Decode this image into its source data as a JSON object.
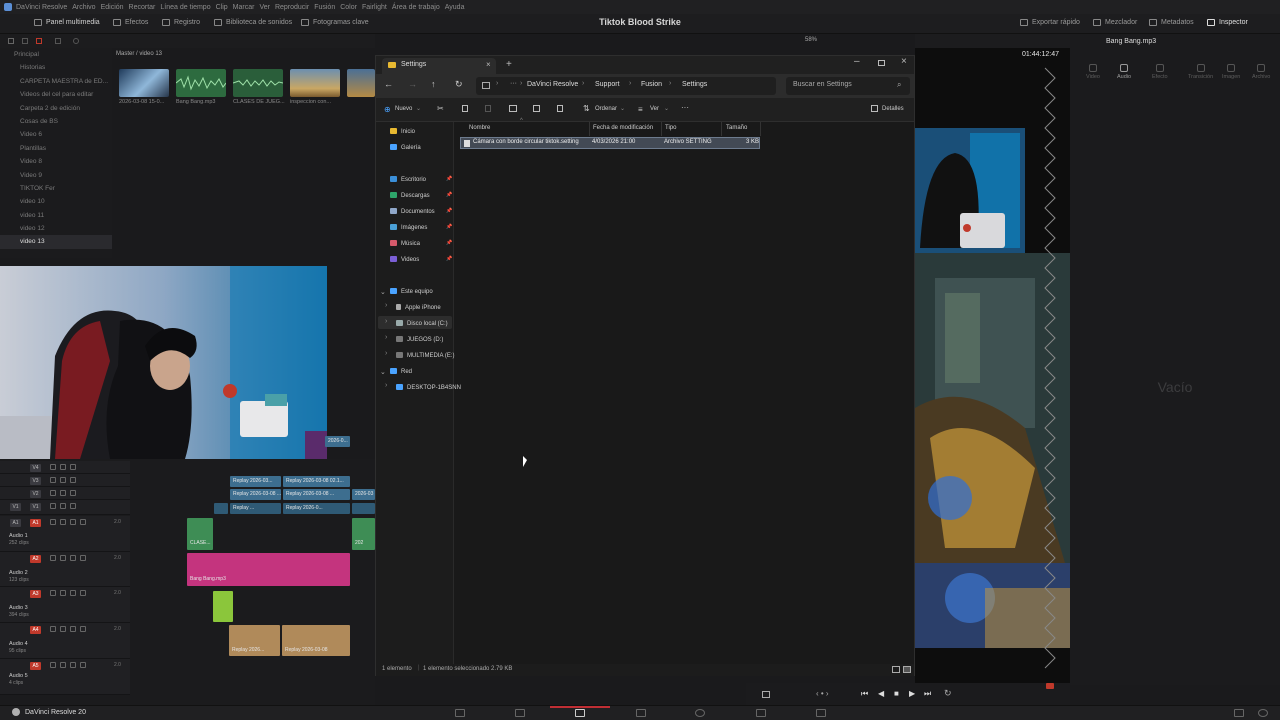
{
  "menubar": {
    "app_name": "DaVinci Resolve",
    "items": [
      "Archivo",
      "Edición",
      "Recortar",
      "Línea de tiempo",
      "Clip",
      "Marcar",
      "Ver",
      "Reproducir",
      "Fusión",
      "Color",
      "Fairlight",
      "Área de trabajo",
      "Ayuda"
    ]
  },
  "toolbar": {
    "left": [
      "Panel multimedia",
      "Efectos",
      "Registro",
      "Biblioteca de sonidos",
      "Fotogramas clave"
    ],
    "project_title": "Tiktok Blood Strike",
    "right": [
      "Exportar rápido",
      "Mezclador",
      "Metadatos",
      "Inspector"
    ],
    "zoom": "58%",
    "timecode": "01:44:12:47",
    "clip_name": "Bang Bang.mp3"
  },
  "media_pool": {
    "path": "Master / video 13",
    "bins": [
      "Principal",
      "Historias",
      "CARPETA MAESTRA de ED...",
      "Videos del cel para editar",
      "Carpeta 2 de edición",
      "Cosas de BS",
      "Video 6",
      "Plantillas",
      "Video 8",
      "Video 9",
      "TIKTOK Fer",
      "video 10",
      "video 11",
      "video 12",
      "video 13"
    ],
    "selected_bin": "video 13",
    "clips": [
      "2026-03-08 15-0...",
      "Bang Bang.mp3",
      "CLASES DE JUEG...",
      "inspeccion con...",
      ""
    ]
  },
  "timeline": {
    "tracks": [
      {
        "tag": "V4",
        "name": "",
        "count": ""
      },
      {
        "tag": "V3",
        "name": "",
        "count": ""
      },
      {
        "tag": "V2",
        "name": "",
        "count": ""
      },
      {
        "tag": "V1",
        "name": "",
        "count": ""
      },
      {
        "tag": "A1",
        "name": "Audio 1",
        "count": "252 clips",
        "db": "2.0"
      },
      {
        "tag": "A2",
        "name": "Audio 2",
        "count": "123 clips",
        "db": "2.0"
      },
      {
        "tag": "A3",
        "name": "Audio 3",
        "count": "394 clips",
        "db": "2.0"
      },
      {
        "tag": "A4",
        "name": "Audio 4",
        "count": "95 clips",
        "db": "2.0"
      },
      {
        "tag": "A5",
        "name": "Audio 5",
        "count": "4 clips",
        "db": "2.0"
      }
    ],
    "clips": {
      "v3_a": "Replay 2026-03...",
      "v3_b": "Replay 2026-03-08 02.1...",
      "v2_a": "Replay 2026-03-08 ...",
      "v2_b": "2026-03",
      "v1_a": "Replay ...",
      "v1_b": "Replay 2026-0...",
      "a1_a": "CLASE...",
      "a1_b": "202",
      "a2": "Bang Bang.mp3",
      "a4_a": "Replay 2026...",
      "a4_b": "Replay 2026-03-08",
      "webcam_clip": "2026-0..."
    }
  },
  "explorer": {
    "tab_title": "Settings",
    "breadcrumb": [
      "DaVinci Resolve",
      "Support",
      "Fusion",
      "Settings"
    ],
    "search_placeholder": "Buscar en Settings",
    "commands": {
      "new": "Nuevo",
      "sort": "Ordenar",
      "view": "Ver",
      "details": "Detalles"
    },
    "sidebar": {
      "top": [
        "Inicio",
        "Galería"
      ],
      "quick": [
        "Escritorio",
        "Descargas",
        "Documentos",
        "Imágenes",
        "Música",
        "Videos"
      ],
      "pc_label": "Este equipo",
      "pc_items": [
        "Apple iPhone",
        "Disco local (C:)",
        "JUEGOS (D:)",
        "MULTIMEDIA (E:)"
      ],
      "network_label": "Red",
      "network_items": [
        "DESKTOP-1B4SNN"
      ]
    },
    "columns": [
      "Nombre",
      "Fecha de modificación",
      "Tipo",
      "Tamaño"
    ],
    "file": {
      "name": "Cámara con borde circular tiktok.setting",
      "date": "4/03/2026 21:00",
      "type": "Archivo SETTING",
      "size": "3 KB"
    },
    "status_count": "1 elemento",
    "status_selected": "1 elemento seleccionado  2.79 KB"
  },
  "inspector": {
    "tabs": [
      "Video",
      "Audio",
      "Efecto",
      "Transición",
      "Imagen",
      "Archivo"
    ],
    "active_tab": "Audio",
    "empty": "Vacío"
  },
  "bottombar": {
    "brand": "DaVinci Resolve 20"
  },
  "colors": {
    "accent_red": "#c02e34",
    "audio_green": "#3e8d55",
    "audio_pink": "#c4347e",
    "audio_lime": "#8bc63b",
    "audio_tan": "#b08a5a",
    "video_blue": "#3d6e8f",
    "selection": "#434a55"
  }
}
